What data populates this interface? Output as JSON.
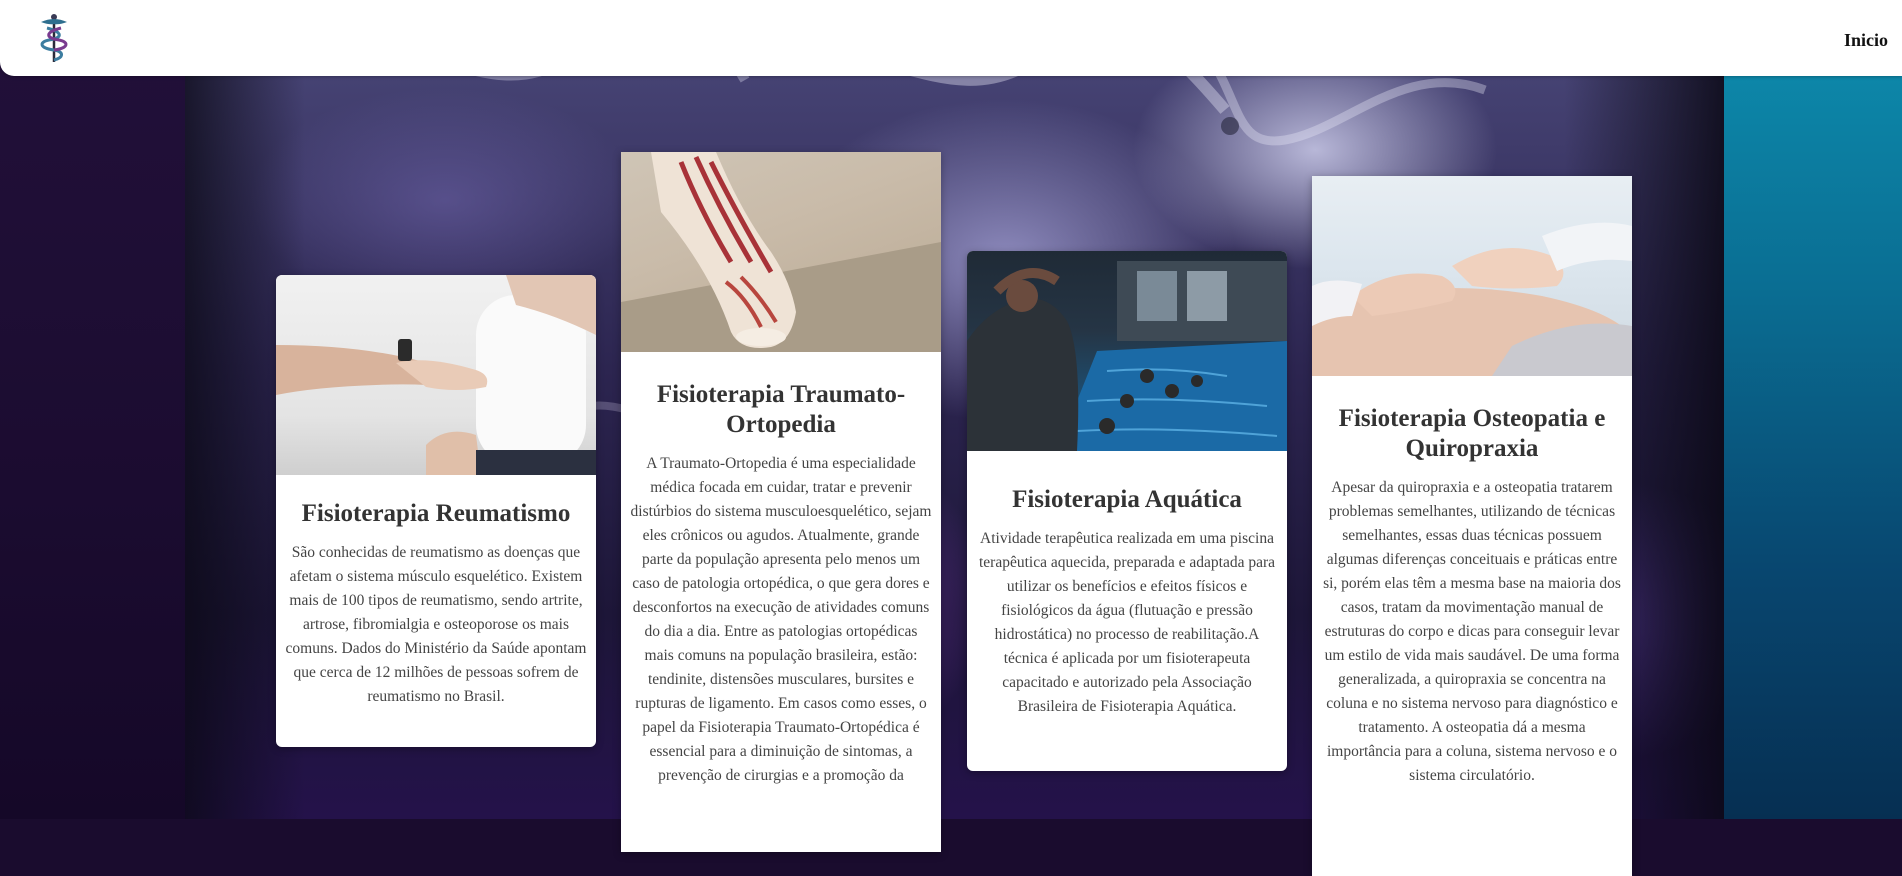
{
  "navbar": {
    "link": "Inicio"
  },
  "cards": [
    {
      "title": "Fisioterapia Reumatismo",
      "text": "São conhecidas de reumatismo as doenças que afetam o sistema músculo esquelético. Existem mais de 100 tipos de reumatismo, sendo artrite, artrose, fibromialgia e osteoporose os mais comuns. Dados do Ministério da Saúde apontam que cerca de 12 milhões de pessoas sofrem de reumatismo no Brasil."
    },
    {
      "title": "Fisioterapia Traumato-Ortopedia",
      "text": "A Traumato-Ortopedia é uma especialidade médica focada em cuidar, tratar e prevenir distúrbios do sistema musculoesquelético, sejam eles crônicos ou agudos. Atualmente, grande parte da população apresenta pelo menos um caso de patologia ortopédica, o que gera dores e desconfortos na execução de atividades comuns do dia a dia. Entre as patologias ortopédicas mais comuns na população brasileira, estão: tendinite, distensões musculares, bursites e rupturas de ligamento. Em casos como esses, o papel da Fisioterapia Traumato-Ortopédica é essencial para a diminuição de sintomas, a prevenção de cirurgias e a promoção da"
    },
    {
      "title": "Fisioterapia Aquática",
      "text": "Atividade terapêutica realizada em uma piscina terapêutica aquecida, preparada e adaptada para utilizar os benefícios e efeitos físicos e fisiológicos da água (flutuação e pressão hidrostática) no processo de reabilitação.A técnica é aplicada por um fisioterapeuta capacitado e autorizado pela Associação Brasileira de Fisioterapia Aquática."
    },
    {
      "title": "Fisioterapia Osteopatia e Quiropraxia",
      "text": "Apesar da quiropraxia e a osteopatia tratarem problemas semelhantes, utilizando de técnicas semelhantes, essas duas técnicas possuem algumas diferenças conceituais e práticas entre si, porém elas têm a mesma base na maioria dos casos, tratam da movimentação manual de estruturas do corpo e dicas para conseguir levar um estilo de vida mais saudável. De uma forma generalizada, a quiropraxia se concentra na coluna e no sistema nervoso para diagnóstico e tratamento. A osteopatia dá a mesma importância para a coluna, sistema nervoso e o sistema circulatório."
    }
  ]
}
